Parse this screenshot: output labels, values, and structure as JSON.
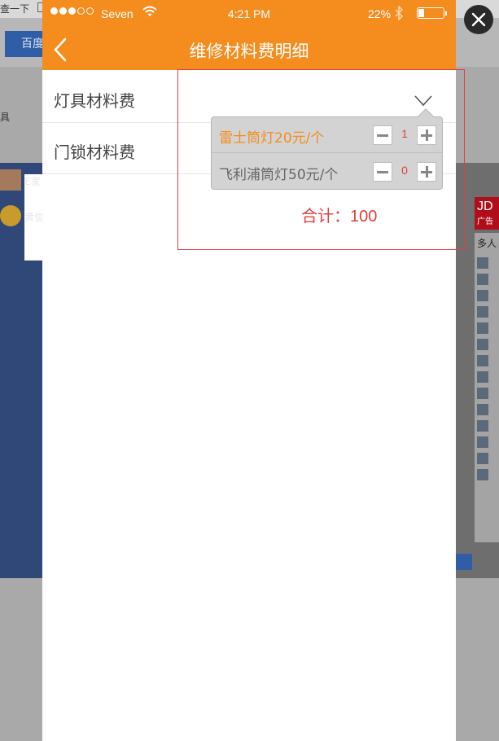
{
  "background": {
    "top_fragment": "查一下",
    "baidu_button": "百度",
    "left_char": "具",
    "left_panel_rows": [
      "E家",
      "黄俊"
    ],
    "jd_badge": "JD",
    "jd_sub": "广告",
    "right_list_title": "多人"
  },
  "status_bar": {
    "carrier": "Seven",
    "time": "4:21 PM",
    "battery_percent": "22%",
    "battery_level": 0.22,
    "signal_filled": 3,
    "signal_total": 5
  },
  "nav": {
    "title": "维修材料费明细",
    "back_icon": "chevron-left-icon"
  },
  "rows": [
    {
      "label": "灯具材料费",
      "expanded": true
    },
    {
      "label": "门锁材料费",
      "expanded": false
    }
  ],
  "popover": {
    "items": [
      {
        "name": "雷士筒灯20元/个",
        "quantity": "1",
        "active": true
      },
      {
        "name": "飞利浦筒灯50元/个",
        "quantity": "0",
        "active": false
      }
    ]
  },
  "total": {
    "label": "合计：",
    "value": "100"
  },
  "colors": {
    "accent": "#f48c1e",
    "danger": "#e04040",
    "popover_bg": "#d3d3d3"
  },
  "icons": {
    "close": "close-icon",
    "wifi": "wifi-icon",
    "bluetooth": "bluetooth-icon",
    "battery": "battery-icon",
    "chevron": "chevron-down-icon",
    "minus": "minus-icon",
    "plus": "plus-icon"
  }
}
